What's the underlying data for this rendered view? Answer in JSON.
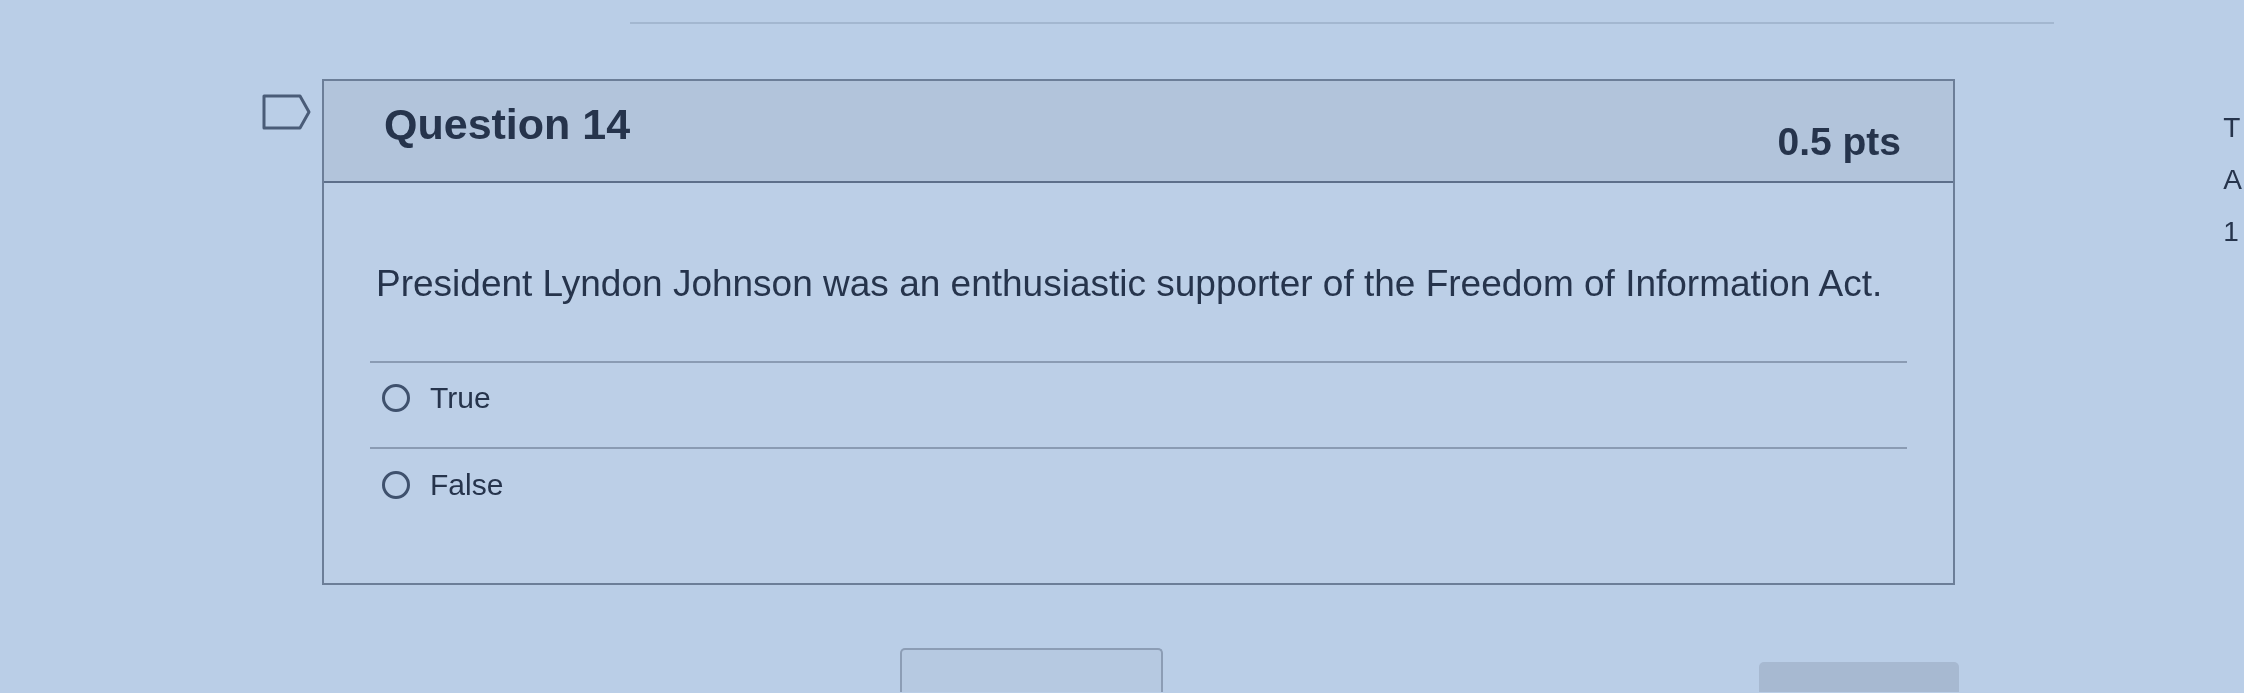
{
  "question": {
    "flagged": false,
    "title": "Question 14",
    "points": "0.5 pts",
    "text": "President Lyndon Johnson was an enthusiastic supporter of the Freedom of Information Act.",
    "answers": [
      {
        "label": "True",
        "selected": false
      },
      {
        "label": "False",
        "selected": false
      }
    ]
  },
  "side_panel": {
    "lines": [
      "T",
      "A",
      "1"
    ]
  }
}
